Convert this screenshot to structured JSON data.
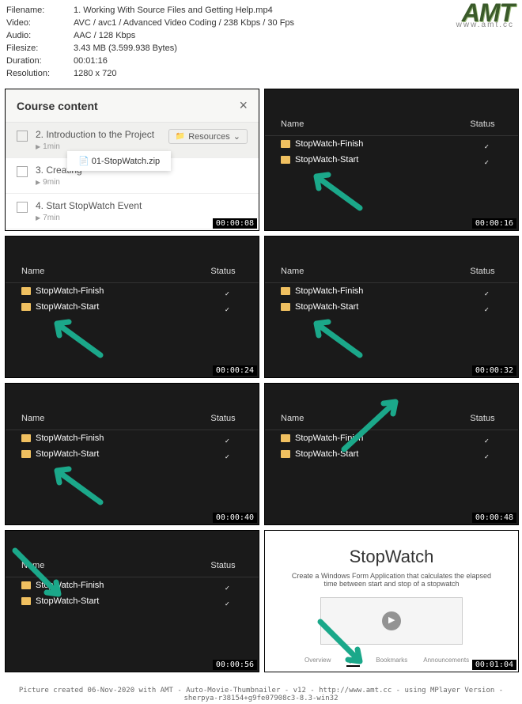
{
  "meta": {
    "filename_label": "Filename:",
    "filename": "1. Working With Source Files and Getting Help.mp4",
    "video_label": "Video:",
    "video": "AVC / avc1 / Advanced Video Coding / 238 Kbps / 30 Fps",
    "audio_label": "Audio:",
    "audio": "AAC / 128 Kbps",
    "filesize_label": "Filesize:",
    "filesize": "3.43 MB (3.599.938 Bytes)",
    "duration_label": "Duration:",
    "duration": "00:01:16",
    "resolution_label": "Resolution:",
    "resolution": "1280 x 720"
  },
  "logo": {
    "text": "AMT",
    "url": "www.amt.cc"
  },
  "course": {
    "title": "Course content",
    "item1": "2. Introduction to the Project",
    "meta1": "1min",
    "resources": "Resources",
    "dropdown": "01-StopWatch.zip",
    "item2": "3. Creating",
    "meta2": "9min",
    "item3": "4. Start StopWatch Event",
    "meta3": "7min"
  },
  "fe": {
    "name_col": "Name",
    "status_col": "Status",
    "folder1": "StopWatch-Finish",
    "folder2": "StopWatch-Start"
  },
  "sw": {
    "title": "StopWatch",
    "sub": "Create a Windows Form Application that calculates the elapsed time between start and stop of a stopwatch",
    "tab1": "Overview",
    "tab2": "Q&A",
    "tab3": "Bookmarks",
    "tab4": "Announcements"
  },
  "ts": {
    "t1": "00:00:08",
    "t2": "00:00:16",
    "t3": "00:00:24",
    "t4": "00:00:32",
    "t5": "00:00:40",
    "t6": "00:00:48",
    "t7": "00:00:56",
    "t8": "00:01:04"
  },
  "footer": "Picture created 06-Nov-2020 with AMT - Auto-Movie-Thumbnailer - v12 - http://www.amt.cc - using MPlayer Version - sherpya-r38154+g9fe07908c3-8.3-win32"
}
